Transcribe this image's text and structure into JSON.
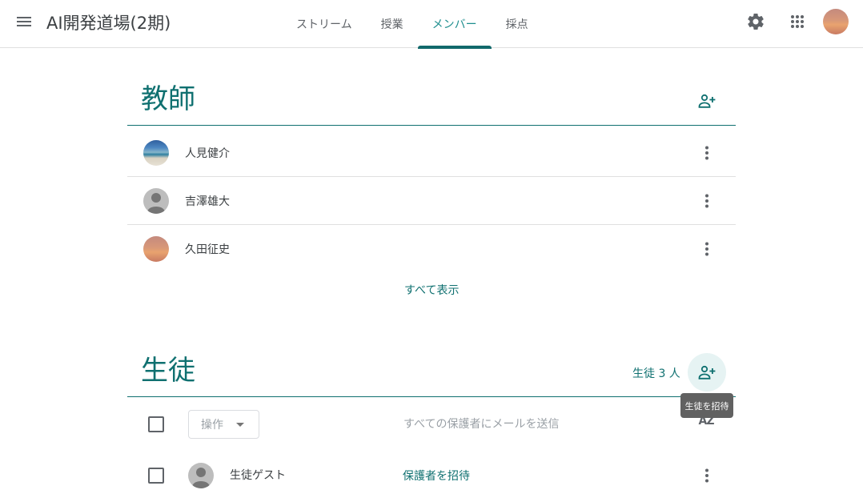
{
  "header": {
    "class_title": "AI開発道場(2期)",
    "tabs": [
      {
        "label": "ストリーム",
        "active": false
      },
      {
        "label": "授業",
        "active": false
      },
      {
        "label": "メンバー",
        "active": true
      },
      {
        "label": "採点",
        "active": false
      }
    ],
    "icons": {
      "menu": "menu-icon",
      "settings": "gear-icon",
      "apps": "apps-grid-icon"
    }
  },
  "teachers": {
    "heading": "教師",
    "add_icon": "person-add-icon",
    "people": [
      {
        "name": "人見健介",
        "avatar": "landscape-photo"
      },
      {
        "name": "吉澤雄大",
        "avatar": "default-person"
      },
      {
        "name": "久田征史",
        "avatar": "sunset-photo"
      }
    ],
    "show_all": "すべて表示"
  },
  "students": {
    "heading": "生徒",
    "count": "生徒 3 人",
    "add_icon": "person-add-icon",
    "add_tooltip": "生徒を招待",
    "actions_label": "操作",
    "email_parents": "すべての保護者にメールを送信",
    "sort_label": "AZ",
    "rows": [
      {
        "name": "生徒ゲスト",
        "invite_guardian": "保護者を招待",
        "avatar": "default-person"
      }
    ]
  },
  "colors": {
    "accent": "#0f7070",
    "tab_active": "#1e8e8e",
    "text": "#3c4043",
    "muted": "#9aa0a6",
    "tooltip_bg": "#616161"
  }
}
